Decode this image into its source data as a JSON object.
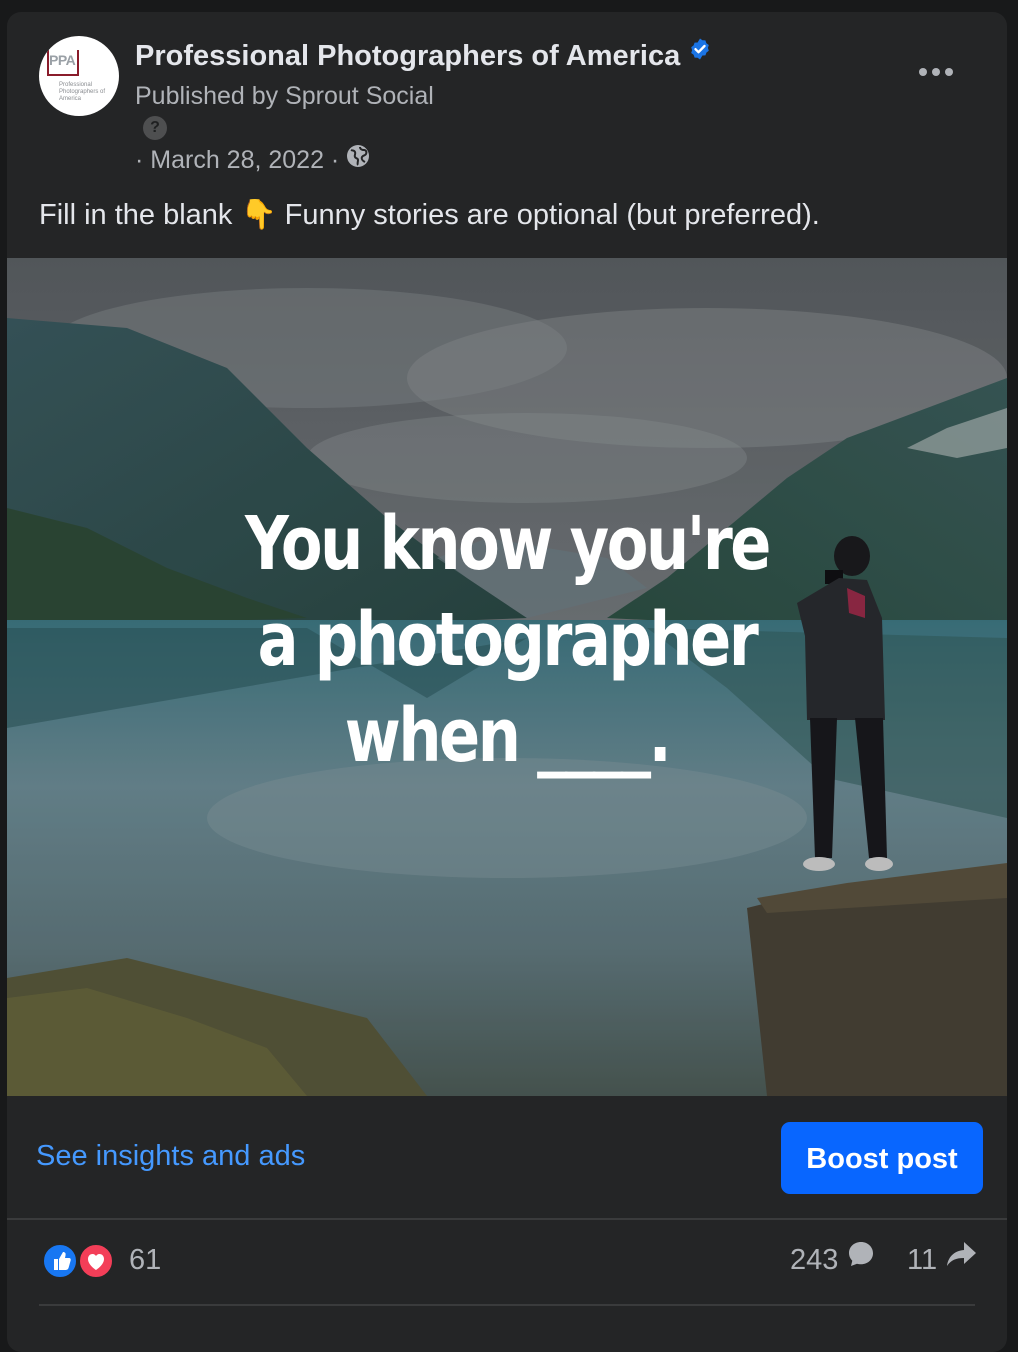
{
  "post": {
    "page_name": "Professional Photographers of America",
    "published_by": "Published by Sprout Social",
    "help_glyph": "?",
    "date": "· March 28, 2022 ·",
    "text": "Fill in the blank 👇 Funny stories are optional (but preferred).",
    "avatar": {
      "logo_text": "PPA",
      "logo_caption": "Professional Photographers of America"
    }
  },
  "image": {
    "overlay_line1": "You know you're",
    "overlay_line2": "a photographer",
    "overlay_line3": "when ____."
  },
  "actions": {
    "insights_label": "See insights and ads",
    "boost_label": "Boost post"
  },
  "stats": {
    "reaction_count": "61",
    "comment_count": "243",
    "share_count": "11"
  },
  "colors": {
    "background": "#18191a",
    "card": "#242526",
    "primary_text": "#e4e6eb",
    "secondary_text": "#b0b3b8",
    "link": "#4599ff",
    "boost_button": "#0866ff",
    "verified": "#1b74e4",
    "like": "#1877f2",
    "love": "#f33e58"
  },
  "icons": {
    "verified": "verified-badge-icon",
    "globe": "globe-icon",
    "more": "more-options-icon",
    "help": "question-mark-icon",
    "like": "like-reaction-icon",
    "love": "love-reaction-icon",
    "comment": "comment-icon",
    "share": "share-icon"
  }
}
